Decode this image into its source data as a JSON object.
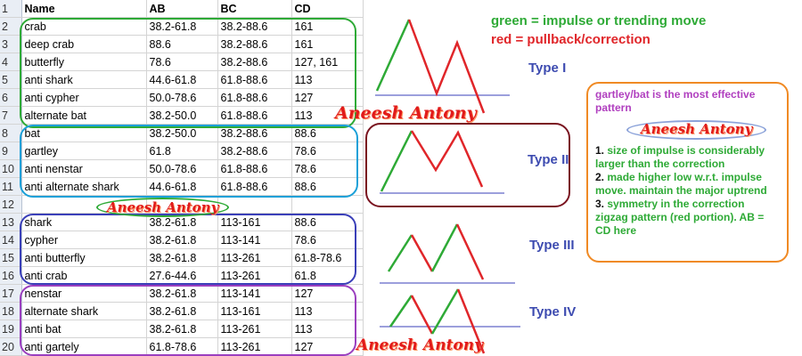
{
  "sheet": {
    "headers": [
      "Name",
      "AB",
      "BC",
      "CD"
    ],
    "rows": [
      {
        "num": "2",
        "cells": [
          "crab",
          "38.2-61.8",
          "38.2-88.6",
          "161"
        ]
      },
      {
        "num": "3",
        "cells": [
          "deep crab",
          "88.6",
          "38.2-88.6",
          "161"
        ]
      },
      {
        "num": "4",
        "cells": [
          "butterfly",
          "78.6",
          "38.2-88.6",
          "127, 161"
        ]
      },
      {
        "num": "5",
        "cells": [
          "anti shark",
          "44.6-61.8",
          "61.8-88.6",
          "113"
        ]
      },
      {
        "num": "6",
        "cells": [
          "anti cypher",
          "50.0-78.6",
          "61.8-88.6",
          "127"
        ]
      },
      {
        "num": "7",
        "cells": [
          "alternate bat",
          "38.2-50.0",
          "61.8-88.6",
          "113"
        ]
      },
      {
        "num": "8",
        "cells": [
          "bat",
          "38.2-50.0",
          "38.2-88.6",
          "88.6"
        ]
      },
      {
        "num": "9",
        "cells": [
          "gartley",
          "61.8",
          "38.2-88.6",
          "78.6"
        ]
      },
      {
        "num": "10",
        "cells": [
          "anti nenstar",
          "50.0-78.6",
          "61.8-88.6",
          "78.6"
        ]
      },
      {
        "num": "11",
        "cells": [
          "anti alternate shark",
          "44.6-61.8",
          "61.8-88.6",
          "88.6"
        ]
      },
      {
        "num": "12",
        "cells": [
          "",
          "",
          "",
          ""
        ]
      },
      {
        "num": "13",
        "cells": [
          "shark",
          "38.2-61.8",
          "113-161",
          "88.6"
        ]
      },
      {
        "num": "14",
        "cells": [
          "cypher",
          "38.2-61.8",
          "113-141",
          "78.6"
        ]
      },
      {
        "num": "15",
        "cells": [
          "anti butterfly",
          "38.2-61.8",
          "113-261",
          "61.8-78.6"
        ]
      },
      {
        "num": "16",
        "cells": [
          "anti crab",
          "27.6-44.6",
          "113-261",
          "61.8"
        ]
      },
      {
        "num": "17",
        "cells": [
          "nenstar",
          "38.2-61.8",
          "113-141",
          "127"
        ]
      },
      {
        "num": "18",
        "cells": [
          "alternate shark",
          "38.2-61.8",
          "113-161",
          "113"
        ]
      },
      {
        "num": "19",
        "cells": [
          "anti bat",
          "38.2-61.8",
          "113-261",
          "113"
        ]
      },
      {
        "num": "20",
        "cells": [
          "anti gartely",
          "61.8-78.6",
          "113-261",
          "127"
        ]
      }
    ]
  },
  "watermark": "Aneesh Antony",
  "legend": {
    "green_line": "green = impulse or trending move",
    "red_line": "red = pullback/correction"
  },
  "types": [
    "Type I",
    "Type II",
    "Type III",
    "Type IV"
  ],
  "notes": {
    "title": "gartley/bat is the most effective pattern",
    "items": [
      {
        "num": "1.",
        "text": "size of impulse is considerably larger than the correction"
      },
      {
        "num": "2.",
        "text": "made higher low w.r.t. impulse move. maintain the major uptrend"
      },
      {
        "num": "3.",
        "text": "symmetry in the correction zigzag pattern (red portion). AB = CD here"
      }
    ]
  },
  "colors": {
    "impulse": "#2eaa36",
    "correction": "#e0262a",
    "group1": "#2eaa36",
    "group2": "#1aa0d8",
    "group3": "#3a3fb8",
    "group4": "#9b3fbf",
    "type2_box": "#7a1420",
    "notes_box": "#f08a24"
  }
}
